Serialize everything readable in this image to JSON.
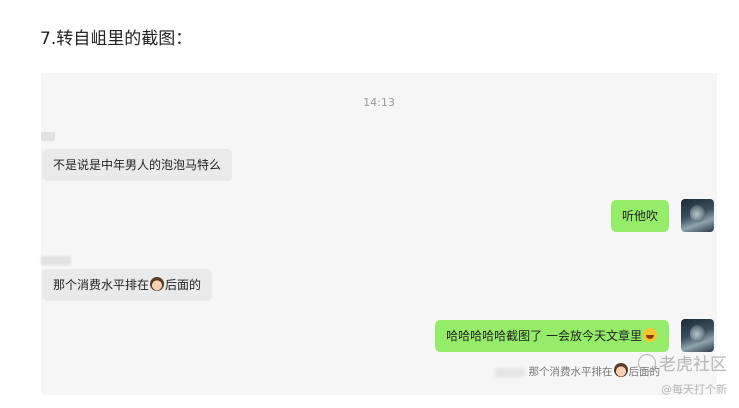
{
  "heading": "7.转自岨里的截图：",
  "chat": {
    "timestamp": "14:13",
    "messages": [
      {
        "direction": "incoming",
        "text": "不是说是中年男人的泡泡马特么"
      },
      {
        "direction": "outgoing",
        "text": "听他吹"
      },
      {
        "direction": "incoming",
        "text_before": "那个消费水平排在",
        "emoji": "girl-face-icon",
        "text_after": "后面的"
      },
      {
        "direction": "outgoing",
        "text": "哈哈哈哈哈截图了 一会放今天文章里",
        "emoji": "laughing-face-icon"
      }
    ],
    "quote": {
      "text_before": "那个消费水平排在",
      "text_after": "后面的"
    }
  },
  "watermark": {
    "line1": "老虎社区",
    "line2": "@每天打个新"
  },
  "colors": {
    "outgoing_bubble": "#95ec69",
    "incoming_bubble": "#eaeaea",
    "chat_background": "#f6f6f6"
  }
}
